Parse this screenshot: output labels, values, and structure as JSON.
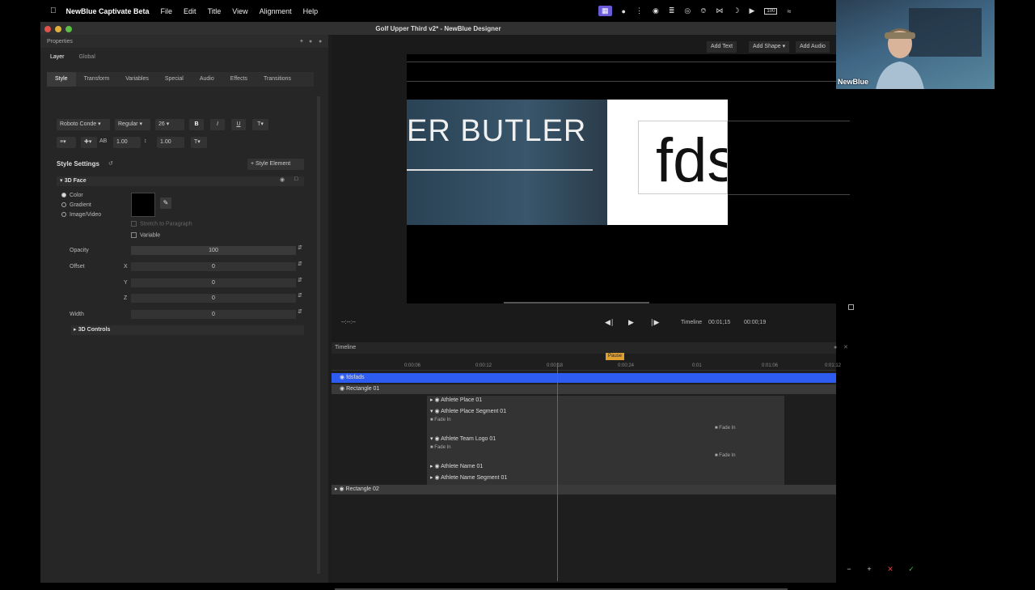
{
  "menubar": {
    "app_name": "NewBlue Captivate Beta",
    "menus": [
      "File",
      "Edit",
      "Title",
      "View",
      "Alignment",
      "Help"
    ],
    "battery": "100"
  },
  "window": {
    "title": "Golf Upper Third v2* - NewBlue Designer"
  },
  "properties": {
    "header": "Properties",
    "scope_tabs": [
      "Layer",
      "Global"
    ],
    "tabs": [
      "Style",
      "Transform",
      "Variables",
      "Special",
      "Audio",
      "Effects",
      "Transitions"
    ],
    "font_family": "Roboto Conde",
    "font_weight": "Regular",
    "font_size": "26",
    "bold": "B",
    "italic": "I",
    "underline": "U",
    "tracking": "1.00",
    "leading": "1.00",
    "style_settings_label": "Style Settings",
    "style_element_button": "+ Style Element",
    "section_3d_face": "3D Face",
    "fill_options": [
      "Color",
      "Gradient",
      "Image/Video"
    ],
    "stretch_label": "Stretch to Paragraph",
    "variable_label": "Variable",
    "opacity_label": "Opacity",
    "opacity_value": "100",
    "offset_label": "Offset",
    "offset_x_label": "X",
    "offset_x": "0",
    "offset_y_label": "Y",
    "offset_y": "0",
    "offset_z_label": "Z",
    "offset_z": "0",
    "width_label": "Width",
    "width_value": "0",
    "section_3d_controls": "3D Controls"
  },
  "preview": {
    "add_text": "Add Text",
    "add_shape": "Add Shape",
    "add_audio": "Add Audio",
    "graphic_name": "ER BUTLER",
    "graphic_text": "fds",
    "timecode_left": "--:--:--",
    "timeline_label": "Timeline",
    "timecode_current": "00:01;15",
    "timecode_end": "00:00;19"
  },
  "timeline": {
    "header": "Timeline",
    "pause_label": "Pause",
    "ticks": [
      "0:00:06",
      "0:00:12",
      "0:00:18",
      "0:00:24",
      "0:01",
      "0:01:06",
      "0:01:12"
    ],
    "tracks": [
      {
        "label": "fdsfads"
      },
      {
        "label": "Rectangle 01"
      },
      {
        "label": "Athlete Place 01"
      },
      {
        "label": "Athlete Place Segment 01"
      },
      {
        "label": "Athlete Team Logo 01"
      },
      {
        "label": "Athlete Name 01"
      },
      {
        "label": "Athlete Name Segment 01"
      },
      {
        "label": "Rectangle 02"
      }
    ],
    "fade_in": "Fade In"
  },
  "webcam": {
    "label": "NewBlue"
  },
  "colors": {
    "selected_track": "#2f5cf0",
    "playhead": "#dd3333",
    "pause_flag": "#e0a030"
  }
}
